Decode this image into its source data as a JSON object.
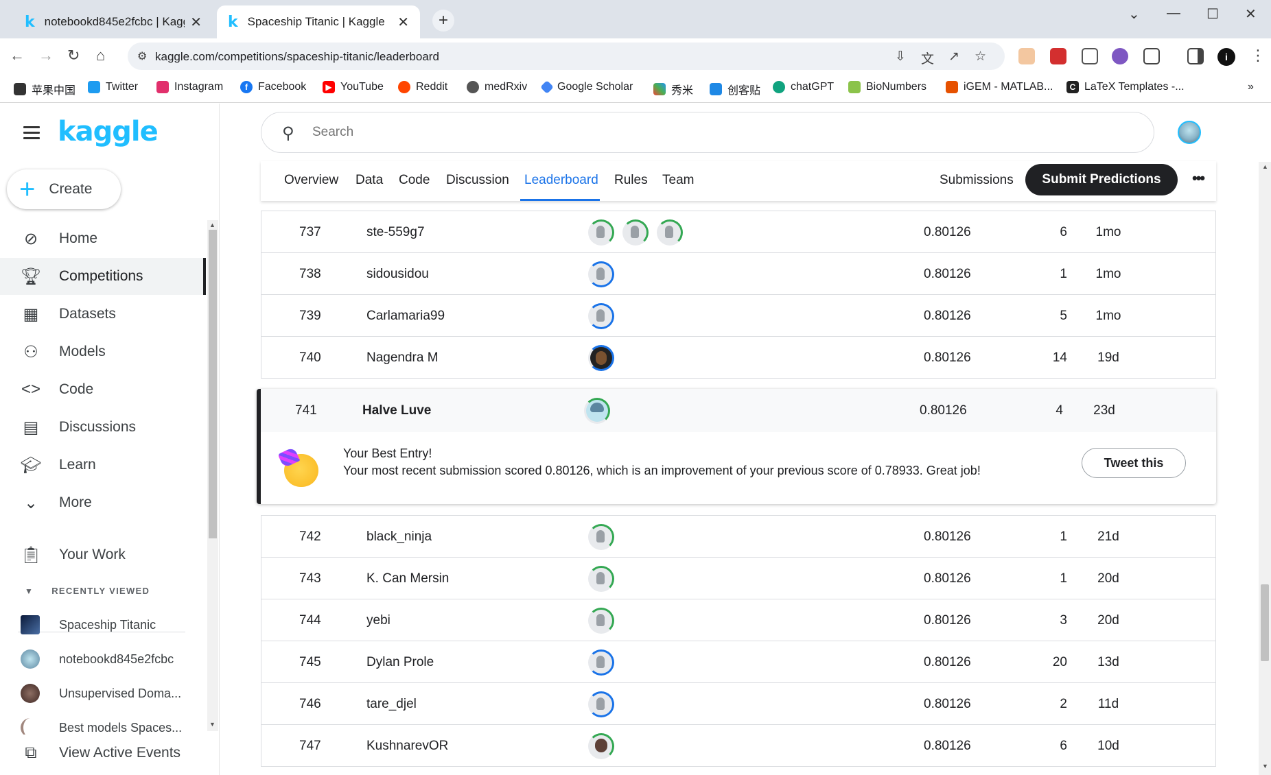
{
  "browser": {
    "tabs": [
      {
        "title": "notebookd845e2fcbc | Kaggl",
        "active": false
      },
      {
        "title": "Spaceship Titanic | Kaggle",
        "active": true
      }
    ],
    "url": "kaggle.com/competitions/spaceship-titanic/leaderboard",
    "bookmarks": [
      "苹果中国",
      "Twitter",
      "Instagram",
      "Facebook",
      "YouTube",
      "Reddit",
      "medRxiv",
      "Google Scholar",
      "秀米",
      "创客贴",
      "chatGPT",
      "BioNumbers",
      "iGEM - MATLAB...",
      "LaTeX Templates -..."
    ]
  },
  "sidebar": {
    "logo": "kaggle",
    "create_label": "Create",
    "items": [
      {
        "label": "Home",
        "icon": "compass-icon"
      },
      {
        "label": "Competitions",
        "icon": "trophy-icon",
        "active": true
      },
      {
        "label": "Datasets",
        "icon": "table-icon"
      },
      {
        "label": "Models",
        "icon": "models-icon"
      },
      {
        "label": "Code",
        "icon": "code-icon"
      },
      {
        "label": "Discussions",
        "icon": "discussion-icon"
      },
      {
        "label": "Learn",
        "icon": "graduation-cap-icon"
      },
      {
        "label": "More",
        "icon": "chevron-down-icon"
      }
    ],
    "your_work": "Your Work",
    "recently_viewed_heading": "RECENTLY VIEWED",
    "recent": [
      "Spaceship Titanic",
      "notebookd845e2fcbc",
      "Unsupervised Doma...",
      "Best models Spaces..."
    ],
    "view_active_events": "View Active Events"
  },
  "search": {
    "placeholder": "Search"
  },
  "subnav": {
    "tabs": [
      "Overview",
      "Data",
      "Code",
      "Discussion",
      "Leaderboard",
      "Rules",
      "Team"
    ],
    "active_tab": "Leaderboard",
    "submissions": "Submissions",
    "submit_button": "Submit Predictions"
  },
  "leaderboard": {
    "rows_above": [
      {
        "rank": "737",
        "name": "ste-559g7",
        "score": "0.80126",
        "entries": "6",
        "last": "1mo"
      },
      {
        "rank": "738",
        "name": "sidousidou",
        "score": "0.80126",
        "entries": "1",
        "last": "1mo"
      },
      {
        "rank": "739",
        "name": "Carlamaria99",
        "score": "0.80126",
        "entries": "5",
        "last": "1mo"
      },
      {
        "rank": "740",
        "name": "Nagendra M",
        "score": "0.80126",
        "entries": "14",
        "last": "19d"
      }
    ],
    "me": {
      "rank": "741",
      "name": "Halve Luve",
      "score": "0.80126",
      "entries": "4",
      "last": "23d"
    },
    "best_entry": {
      "title": "Your Best Entry!",
      "text": "Your most recent submission scored 0.80126, which is an improvement of your previous score of 0.78933. Great job!",
      "tweet_button": "Tweet this"
    },
    "rows_below": [
      {
        "rank": "742",
        "name": "black_ninja",
        "score": "0.80126",
        "entries": "1",
        "last": "21d"
      },
      {
        "rank": "743",
        "name": "K. Can Mersin",
        "score": "0.80126",
        "entries": "1",
        "last": "20d"
      },
      {
        "rank": "744",
        "name": "yebi",
        "score": "0.80126",
        "entries": "3",
        "last": "20d"
      },
      {
        "rank": "745",
        "name": "Dylan Prole",
        "score": "0.80126",
        "entries": "20",
        "last": "13d"
      },
      {
        "rank": "746",
        "name": "tare_djel",
        "score": "0.80126",
        "entries": "2",
        "last": "11d"
      },
      {
        "rank": "747",
        "name": "KushnarevOR",
        "score": "0.80126",
        "entries": "6",
        "last": "10d"
      }
    ]
  }
}
